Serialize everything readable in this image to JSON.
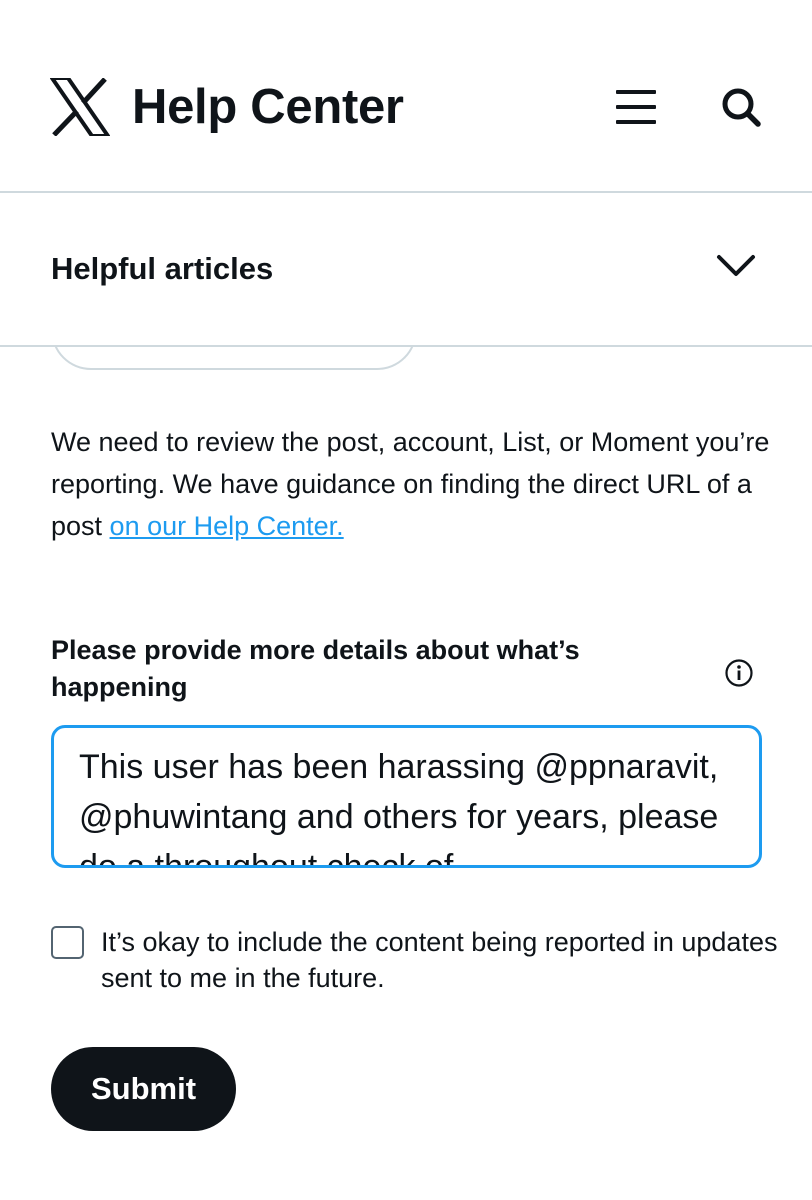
{
  "header": {
    "logo_icon": "x-logo-icon",
    "title": "Help Center",
    "menu_icon": "hamburger-menu-icon",
    "search_icon": "search-icon"
  },
  "accordion": {
    "title": "Helpful articles",
    "expanded": false,
    "chevron_icon": "chevron-down-icon"
  },
  "info": {
    "text": "We need to review the post, account, List, or Moment you’re reporting. We have guidance on finding the direct URL of a post ",
    "link_text": "on our Help Center."
  },
  "details": {
    "label": "Please provide more details about what’s happening",
    "info_icon": "info-icon",
    "value": "This user has been harassing @ppnaravit, @phuwintang and others for years, please do a throughout check of"
  },
  "consent": {
    "checked": false,
    "label": "It’s okay to include the content being reported in updates sent to me in the future."
  },
  "submit": {
    "label": "Submit"
  },
  "colors": {
    "text": "#0f1419",
    "accent": "#1d9bf0",
    "border": "#cfd9de",
    "button_bg": "#0f1419",
    "button_text": "#ffffff"
  }
}
